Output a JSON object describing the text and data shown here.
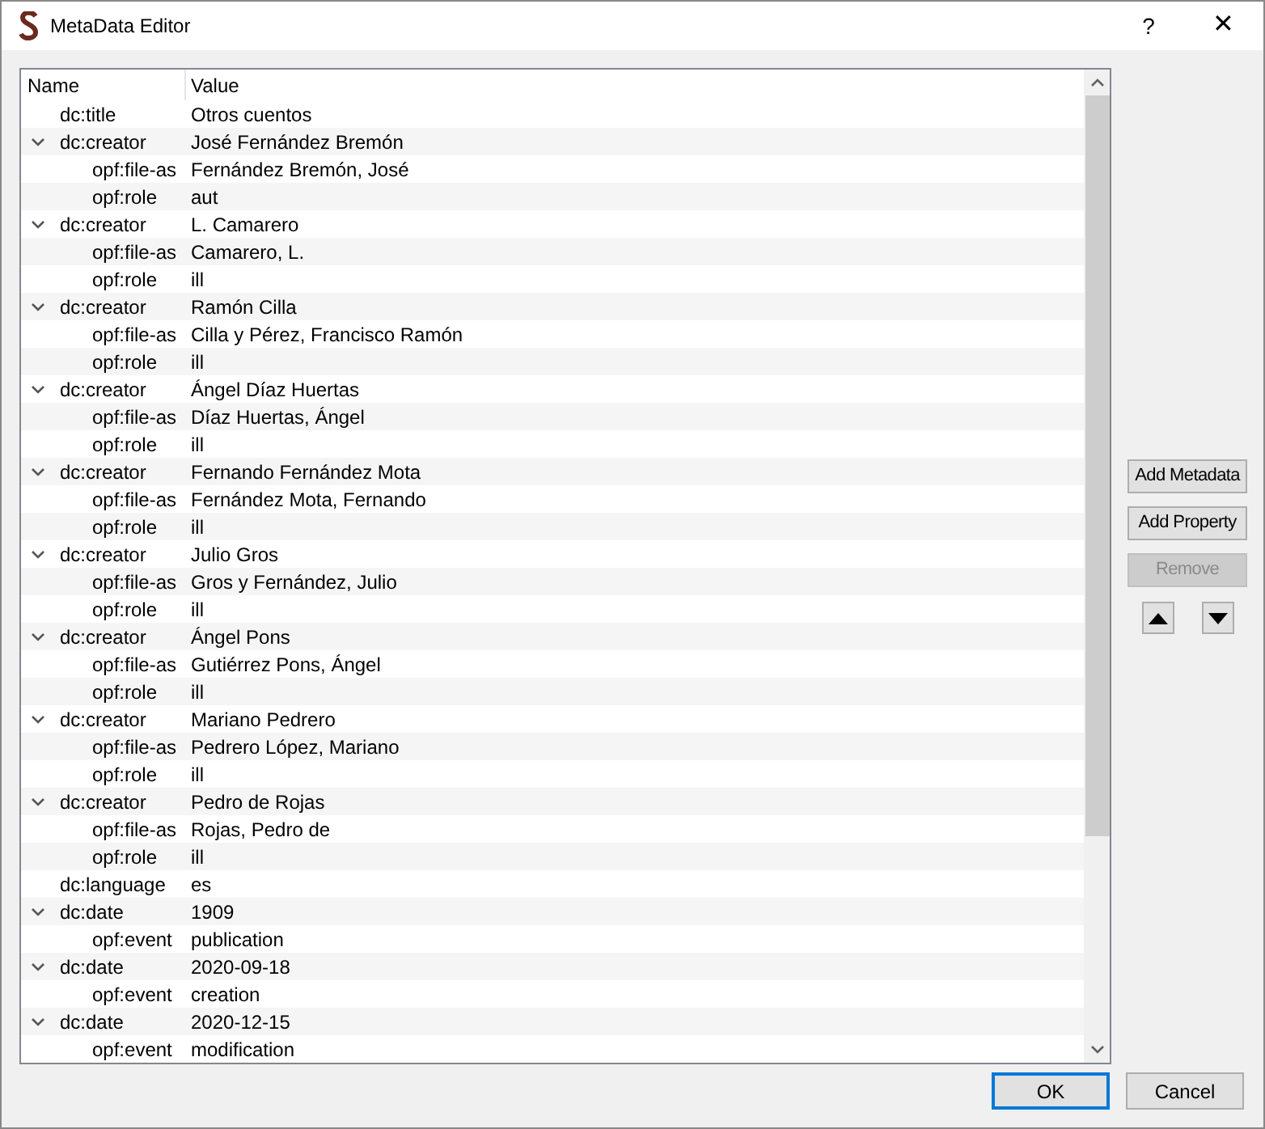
{
  "window": {
    "title": "MetaData Editor",
    "help": "?",
    "close": "✕"
  },
  "table": {
    "columns": [
      "Name",
      "Value"
    ],
    "rows": [
      {
        "name": "dc:title",
        "value": "Otros cuentos"
      },
      {
        "name": "dc:creator",
        "value": "José Fernández Bremón",
        "expanded": true,
        "children": [
          {
            "name": "opf:file-as",
            "value": "Fernández Bremón, José"
          },
          {
            "name": "opf:role",
            "value": "aut"
          }
        ]
      },
      {
        "name": "dc:creator",
        "value": "L. Camarero",
        "expanded": true,
        "children": [
          {
            "name": "opf:file-as",
            "value": "Camarero, L."
          },
          {
            "name": "opf:role",
            "value": "ill"
          }
        ]
      },
      {
        "name": "dc:creator",
        "value": "Ramón Cilla",
        "expanded": true,
        "children": [
          {
            "name": "opf:file-as",
            "value": "Cilla y Pérez, Francisco Ramón"
          },
          {
            "name": "opf:role",
            "value": "ill"
          }
        ]
      },
      {
        "name": "dc:creator",
        "value": "Ángel Díaz Huertas",
        "expanded": true,
        "children": [
          {
            "name": "opf:file-as",
            "value": "Díaz Huertas, Ángel"
          },
          {
            "name": "opf:role",
            "value": "ill"
          }
        ]
      },
      {
        "name": "dc:creator",
        "value": "Fernando Fernández Mota",
        "expanded": true,
        "children": [
          {
            "name": "opf:file-as",
            "value": "Fernández Mota, Fernando"
          },
          {
            "name": "opf:role",
            "value": "ill"
          }
        ]
      },
      {
        "name": "dc:creator",
        "value": "Julio Gros",
        "expanded": true,
        "children": [
          {
            "name": "opf:file-as",
            "value": "Gros y Fernández, Julio"
          },
          {
            "name": "opf:role",
            "value": "ill"
          }
        ]
      },
      {
        "name": "dc:creator",
        "value": "Ángel Pons",
        "expanded": true,
        "children": [
          {
            "name": "opf:file-as",
            "value": "Gutiérrez Pons, Ángel"
          },
          {
            "name": "opf:role",
            "value": "ill"
          }
        ]
      },
      {
        "name": "dc:creator",
        "value": "Mariano Pedrero",
        "expanded": true,
        "children": [
          {
            "name": "opf:file-as",
            "value": "Pedrero López, Mariano"
          },
          {
            "name": "opf:role",
            "value": "ill"
          }
        ]
      },
      {
        "name": "dc:creator",
        "value": "Pedro de Rojas",
        "expanded": true,
        "children": [
          {
            "name": "opf:file-as",
            "value": "Rojas, Pedro de"
          },
          {
            "name": "opf:role",
            "value": "ill"
          }
        ]
      },
      {
        "name": "dc:language",
        "value": "es"
      },
      {
        "name": "dc:date",
        "value": "1909",
        "expanded": true,
        "children": [
          {
            "name": "opf:event",
            "value": "publication"
          }
        ]
      },
      {
        "name": "dc:date",
        "value": "2020-09-18",
        "expanded": true,
        "children": [
          {
            "name": "opf:event",
            "value": "creation"
          }
        ]
      },
      {
        "name": "dc:date",
        "value": "2020-12-15",
        "expanded": true,
        "children": [
          {
            "name": "opf:event",
            "value": "modification"
          }
        ]
      }
    ]
  },
  "side_buttons": [
    {
      "label": "Add Metadata",
      "disabled": false
    },
    {
      "label": "Add Property",
      "disabled": false
    },
    {
      "label": "Remove",
      "disabled": true
    }
  ],
  "footer_buttons": [
    {
      "label": "OK",
      "selected": true
    },
    {
      "label": "Cancel",
      "selected": false
    }
  ]
}
